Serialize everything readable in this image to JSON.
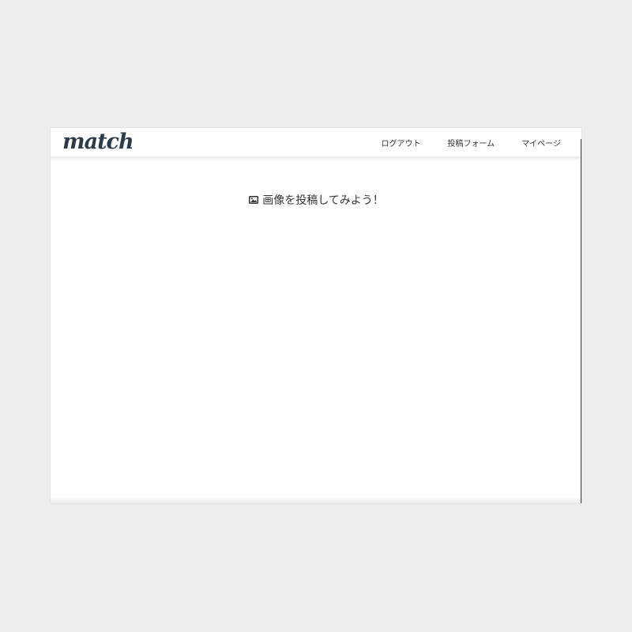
{
  "header": {
    "logo_text": "match",
    "nav": [
      {
        "label": "ログアウト"
      },
      {
        "label": "投稿フォーム"
      },
      {
        "label": "マイページ"
      }
    ]
  },
  "main": {
    "heading_icon": "image-icon",
    "heading": "画像を投稿してみよう！"
  },
  "colors": {
    "page_background": "#efedee",
    "logo": "#2c3b4a",
    "text": "#333333"
  }
}
